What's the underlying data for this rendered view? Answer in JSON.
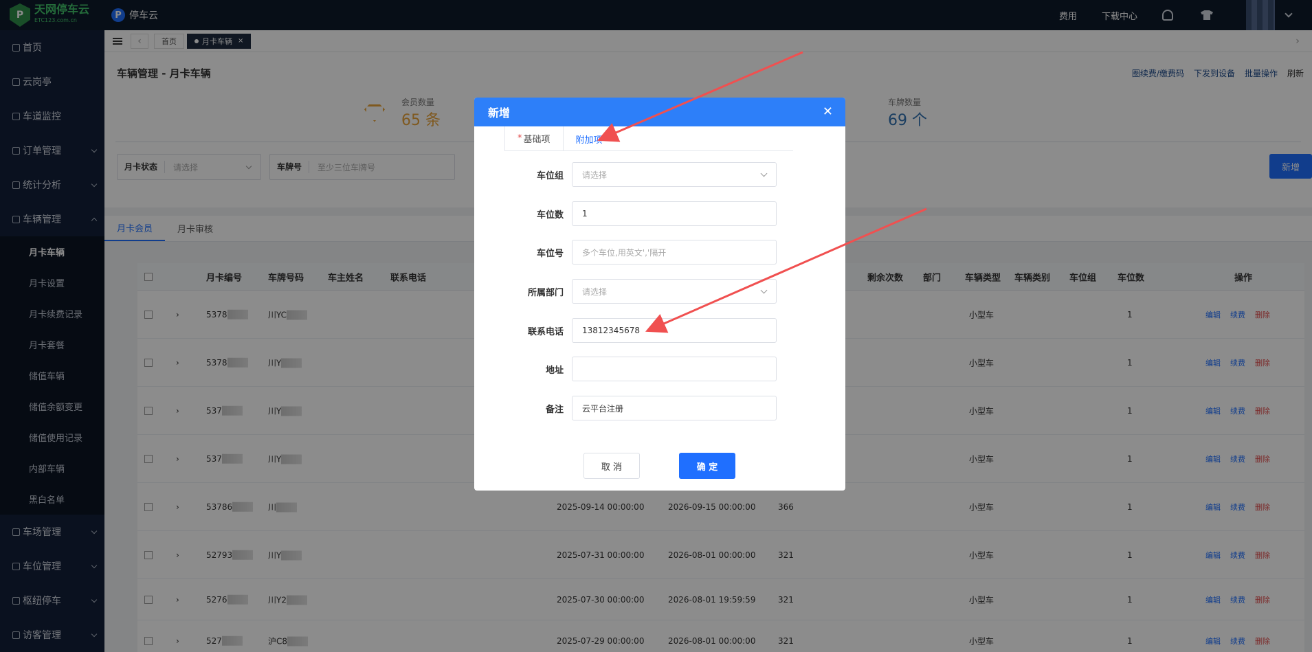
{
  "header": {
    "logo_name": "天网停车云",
    "logo_sub": "ETC123.com.cn",
    "app_name": "停车云",
    "links": [
      "费用",
      "下载中心"
    ]
  },
  "sidebar": {
    "items": [
      {
        "label": "首页",
        "icon": "home-icon"
      },
      {
        "label": "云岗亭",
        "icon": "booth-icon"
      },
      {
        "label": "车道监控",
        "icon": "monitor-icon"
      },
      {
        "label": "订单管理",
        "icon": "order-icon"
      },
      {
        "label": "统计分析",
        "icon": "chart-icon"
      },
      {
        "label": "车辆管理",
        "icon": "car-icon"
      }
    ],
    "sub_items": [
      "月卡车辆",
      "月卡设置",
      "月卡续费记录",
      "月卡套餐",
      "储值车辆",
      "储值余额变更",
      "储值使用记录",
      "内部车辆",
      "黑白名单"
    ],
    "bottom_items": [
      {
        "label": "车场管理",
        "icon": "lot-icon"
      },
      {
        "label": "车位管理",
        "icon": "space-icon"
      },
      {
        "label": "枢纽停车",
        "icon": "hub-icon"
      },
      {
        "label": "访客管理",
        "icon": "visitor-icon"
      }
    ]
  },
  "tabs": {
    "home": "首页",
    "current": "月卡车辆"
  },
  "page": {
    "title": "车辆管理 - 月卡车辆",
    "actions": [
      "圈续费/缴费码",
      "下发到设备",
      "批量操作",
      "刷新"
    ],
    "stats": [
      {
        "label": "会员数量",
        "value": "65 条",
        "color": "#e8a23a"
      },
      {
        "label": "车牌数量",
        "value": "69 个",
        "color": "#2f6fb0"
      }
    ],
    "filters": [
      {
        "label": "月卡状态",
        "placeholder": "请选择"
      },
      {
        "label": "车牌号",
        "placeholder": "至少三位车牌号"
      }
    ],
    "add_button": "新增",
    "subtabs": [
      "月卡会员",
      "月卡审核"
    ]
  },
  "table": {
    "columns_left": [
      "月卡编号",
      "车牌号码",
      "车主姓名",
      "联系电话"
    ],
    "columns_right": [
      "剩余次数",
      "部门",
      "车辆类型",
      "车辆类别",
      "车位组",
      "车位数",
      "操作"
    ],
    "rows": [
      {
        "id": "5378",
        "plate": "川YC",
        "start": "",
        "end": "",
        "days": "",
        "type": "小型车",
        "spaces": "1"
      },
      {
        "id": "5378",
        "plate": "川Y",
        "start": "",
        "end": "",
        "days": "",
        "type": "小型车",
        "spaces": "1"
      },
      {
        "id": "537",
        "plate": "川Y",
        "start": "",
        "end": "",
        "days": "",
        "type": "小型车",
        "spaces": "1"
      },
      {
        "id": "537",
        "plate": "川Y",
        "start": "",
        "end": "",
        "days": "",
        "type": "小型车",
        "spaces": "1"
      },
      {
        "id": "53786",
        "plate": "川",
        "start": "2025-09-14 00:00:00",
        "end": "2026-09-15 00:00:00",
        "days": "366",
        "type": "小型车",
        "spaces": "1"
      },
      {
        "id": "52793",
        "plate": "川Y",
        "start": "2025-07-31 00:00:00",
        "end": "2026-08-01 00:00:00",
        "days": "321",
        "type": "小型车",
        "spaces": "1"
      },
      {
        "id": "5276",
        "plate": "川Y2",
        "start": "2025-07-30 00:00:00",
        "end": "2026-08-01 19:59:59",
        "days": "321",
        "type": "小型车",
        "spaces": "1"
      },
      {
        "id": "527",
        "plate": "沪C8",
        "start": "2025-07-29 00:00:00",
        "end": "2026-08-01 00:00:00",
        "days": "321",
        "type": "小型车",
        "spaces": "1"
      }
    ],
    "ops": [
      "编辑",
      "续费",
      "删除"
    ]
  },
  "modal": {
    "title": "新增",
    "tabs": [
      "基础项",
      "附加项"
    ],
    "fields": [
      {
        "label": "车位组",
        "value": "",
        "placeholder": "请选择",
        "select": true
      },
      {
        "label": "车位数",
        "value": "1",
        "placeholder": ""
      },
      {
        "label": "车位号",
        "value": "",
        "placeholder": "多个车位,用英文','隔开"
      },
      {
        "label": "所属部门",
        "value": "",
        "placeholder": "请选择",
        "select": true
      },
      {
        "label": "联系电话",
        "value": "13812345678",
        "placeholder": ""
      },
      {
        "label": "地址",
        "value": "",
        "placeholder": ""
      },
      {
        "label": "备注",
        "value": "云平台注册",
        "placeholder": ""
      }
    ],
    "cancel": "取 消",
    "ok": "确 定"
  },
  "annotation_color": "#f05050"
}
